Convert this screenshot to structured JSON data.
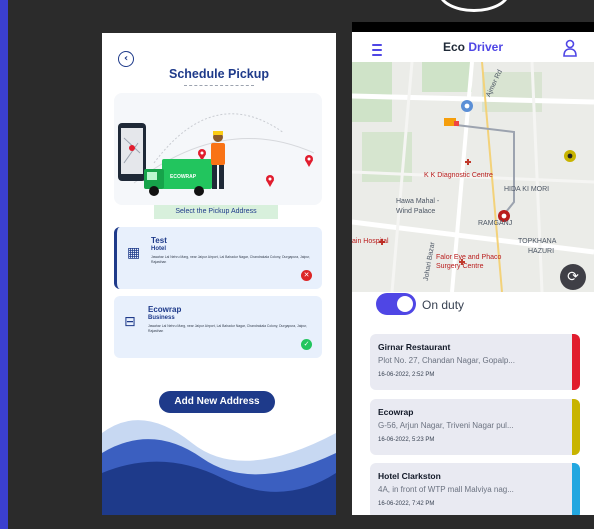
{
  "left": {
    "title": "Schedule Pickup",
    "hero_brand": "ECOWRAP",
    "select_label": "Select the Pickup Address",
    "addresses": [
      {
        "name": "Test",
        "type": "Hotel",
        "address": "Jawahar Lal Nehru Marg, near Jaipur Airport, Lal Bahadur Nagar, Chandrakala Colony, Durgapura, Jaipur, Rajasthan",
        "status": "rejected"
      },
      {
        "name": "Ecowrap",
        "type": "Business",
        "address": "Jawahar Lal Nehru Marg, near Jaipur Airport, Lal Bahadur Nagar, Chandrakala Colony, Durgapura, Jaipur, Rajasthan",
        "status": "approved"
      }
    ],
    "add_button": "Add New Address"
  },
  "right": {
    "app_name": "Eco",
    "app_name_accent": "Driver",
    "map_labels": {
      "road": "Ajmer Rd",
      "diagnostic": "K K Diagnostic Centre",
      "hida": "HIDA KI MORI",
      "hawa": "Hawa Mahal -",
      "wind": "Wind Palace",
      "ram": "RAMGANJ",
      "hospital": "ain Hospital",
      "johari": "Johari Bazar",
      "falor1": "Falor Eye and Phaco",
      "falor2": "Surgery Centre",
      "topkhana": "TOPKHANA",
      "hazuri": "HAZURI"
    },
    "duty_label": "On duty",
    "accent": "#4f46e5",
    "orders": [
      {
        "name": "Girnar Restaurant",
        "address": "Plot No. 27, Chandan Nagar, Gopalp...",
        "time": "16-06-2022, 2:52 PM",
        "color": "#e11d2e"
      },
      {
        "name": "Ecowrap",
        "address": "G-56, Arjun Nagar, Triveni Nagar pul...",
        "time": "16-06-2022, 5:23 PM",
        "color": "#c8b400"
      },
      {
        "name": "Hotel Clarkston",
        "address": "4A, in front of WTP mall  Malviya nag...",
        "time": "16-06-2022, 7:42 PM",
        "color": "#22a7e0"
      }
    ]
  }
}
